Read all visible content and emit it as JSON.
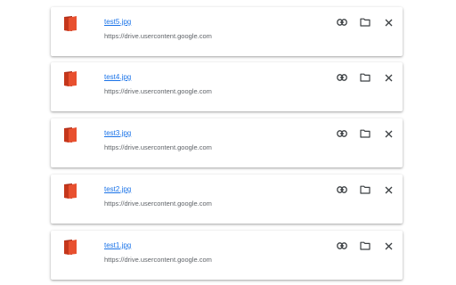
{
  "downloads": {
    "items": [
      {
        "name": "test5.jpg",
        "url": "https://drive.usercontent.google.com",
        "icon": "image-file-icon"
      },
      {
        "name": "test4.jpg",
        "url": "https://drive.usercontent.google.com",
        "icon": "image-file-icon"
      },
      {
        "name": "test3.jpg",
        "url": "https://drive.usercontent.google.com",
        "icon": "image-file-icon"
      },
      {
        "name": "test2.jpg",
        "url": "https://drive.usercontent.google.com",
        "icon": "image-file-icon"
      },
      {
        "name": "test1.jpg",
        "url": "https://drive.usercontent.google.com",
        "icon": "image-file-icon"
      }
    ],
    "actions": {
      "copy_link_icon": "link-icon",
      "show_in_folder_icon": "folder-icon",
      "remove_icon": "close-icon"
    },
    "colors": {
      "link": "#1a73e8",
      "url_text": "#5f6368",
      "icon_red": "#d93025",
      "icon_dark_red": "#a52714",
      "action_icon": "#3c4043"
    }
  }
}
